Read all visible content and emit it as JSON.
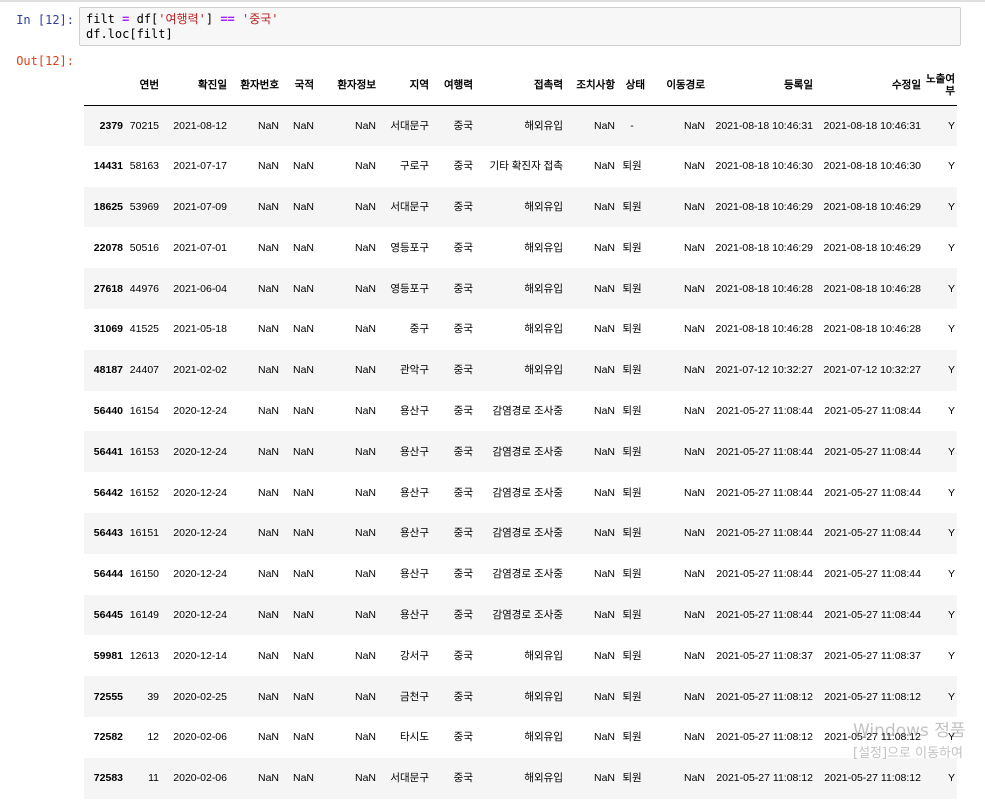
{
  "input_prompt": "In [12]:",
  "output_prompt": "Out[12]:",
  "code": {
    "line1_var": "filt",
    "line1_eq": " = ",
    "line1_df": "df[",
    "line1_key": "'여행력'",
    "line1_close": "] ",
    "line1_op": "==",
    "line1_val": " '중국'",
    "line2": "df.loc[filt]"
  },
  "table": {
    "columns": [
      "",
      "연번",
      "확진일",
      "환자번호",
      "국적",
      "환자정보",
      "지역",
      "여행력",
      "접촉력",
      "조치사항",
      "상태",
      "이동경로",
      "등록일",
      "수정일",
      "노출여부"
    ],
    "rows": [
      {
        "idx": "2379",
        "cells": [
          "70215",
          "2021-08-12",
          "NaN",
          "NaN",
          "NaN",
          "서대문구",
          "중국",
          "해외유입",
          "NaN",
          "-",
          "NaN",
          "2021-08-18 10:46:31",
          "2021-08-18 10:46:31",
          "Y"
        ]
      },
      {
        "idx": "14431",
        "cells": [
          "58163",
          "2021-07-17",
          "NaN",
          "NaN",
          "NaN",
          "구로구",
          "중국",
          "기타 확진자 접촉",
          "NaN",
          "퇴원",
          "NaN",
          "2021-08-18 10:46:30",
          "2021-08-18 10:46:30",
          "Y"
        ]
      },
      {
        "idx": "18625",
        "cells": [
          "53969",
          "2021-07-09",
          "NaN",
          "NaN",
          "NaN",
          "서대문구",
          "중국",
          "해외유입",
          "NaN",
          "퇴원",
          "NaN",
          "2021-08-18 10:46:29",
          "2021-08-18 10:46:29",
          "Y"
        ]
      },
      {
        "idx": "22078",
        "cells": [
          "50516",
          "2021-07-01",
          "NaN",
          "NaN",
          "NaN",
          "영등포구",
          "중국",
          "해외유입",
          "NaN",
          "퇴원",
          "NaN",
          "2021-08-18 10:46:29",
          "2021-08-18 10:46:29",
          "Y"
        ]
      },
      {
        "idx": "27618",
        "cells": [
          "44976",
          "2021-06-04",
          "NaN",
          "NaN",
          "NaN",
          "영등포구",
          "중국",
          "해외유입",
          "NaN",
          "퇴원",
          "NaN",
          "2021-08-18 10:46:28",
          "2021-08-18 10:46:28",
          "Y"
        ]
      },
      {
        "idx": "31069",
        "cells": [
          "41525",
          "2021-05-18",
          "NaN",
          "NaN",
          "NaN",
          "중구",
          "중국",
          "해외유입",
          "NaN",
          "퇴원",
          "NaN",
          "2021-08-18 10:46:28",
          "2021-08-18 10:46:28",
          "Y"
        ]
      },
      {
        "idx": "48187",
        "cells": [
          "24407",
          "2021-02-02",
          "NaN",
          "NaN",
          "NaN",
          "관악구",
          "중국",
          "해외유입",
          "NaN",
          "퇴원",
          "NaN",
          "2021-07-12 10:32:27",
          "2021-07-12 10:32:27",
          "Y"
        ]
      },
      {
        "idx": "56440",
        "cells": [
          "16154",
          "2020-12-24",
          "NaN",
          "NaN",
          "NaN",
          "용산구",
          "중국",
          "감염경로 조사중",
          "NaN",
          "퇴원",
          "NaN",
          "2021-05-27 11:08:44",
          "2021-05-27 11:08:44",
          "Y"
        ]
      },
      {
        "idx": "56441",
        "cells": [
          "16153",
          "2020-12-24",
          "NaN",
          "NaN",
          "NaN",
          "용산구",
          "중국",
          "감염경로 조사중",
          "NaN",
          "퇴원",
          "NaN",
          "2021-05-27 11:08:44",
          "2021-05-27 11:08:44",
          "Y"
        ]
      },
      {
        "idx": "56442",
        "cells": [
          "16152",
          "2020-12-24",
          "NaN",
          "NaN",
          "NaN",
          "용산구",
          "중국",
          "감염경로 조사중",
          "NaN",
          "퇴원",
          "NaN",
          "2021-05-27 11:08:44",
          "2021-05-27 11:08:44",
          "Y"
        ]
      },
      {
        "idx": "56443",
        "cells": [
          "16151",
          "2020-12-24",
          "NaN",
          "NaN",
          "NaN",
          "용산구",
          "중국",
          "감염경로 조사중",
          "NaN",
          "퇴원",
          "NaN",
          "2021-05-27 11:08:44",
          "2021-05-27 11:08:44",
          "Y"
        ]
      },
      {
        "idx": "56444",
        "cells": [
          "16150",
          "2020-12-24",
          "NaN",
          "NaN",
          "NaN",
          "용산구",
          "중국",
          "감염경로 조사중",
          "NaN",
          "퇴원",
          "NaN",
          "2021-05-27 11:08:44",
          "2021-05-27 11:08:44",
          "Y"
        ]
      },
      {
        "idx": "56445",
        "cells": [
          "16149",
          "2020-12-24",
          "NaN",
          "NaN",
          "NaN",
          "용산구",
          "중국",
          "감염경로 조사중",
          "NaN",
          "퇴원",
          "NaN",
          "2021-05-27 11:08:44",
          "2021-05-27 11:08:44",
          "Y"
        ]
      },
      {
        "idx": "59981",
        "cells": [
          "12613",
          "2020-12-14",
          "NaN",
          "NaN",
          "NaN",
          "강서구",
          "중국",
          "해외유입",
          "NaN",
          "퇴원",
          "NaN",
          "2021-05-27 11:08:37",
          "2021-05-27 11:08:37",
          "Y"
        ]
      },
      {
        "idx": "72555",
        "cells": [
          "39",
          "2020-02-25",
          "NaN",
          "NaN",
          "NaN",
          "금천구",
          "중국",
          "해외유입",
          "NaN",
          "퇴원",
          "NaN",
          "2021-05-27 11:08:12",
          "2021-05-27 11:08:12",
          "Y"
        ]
      },
      {
        "idx": "72582",
        "cells": [
          "12",
          "2020-02-06",
          "NaN",
          "NaN",
          "NaN",
          "타시도",
          "중국",
          "해외유입",
          "NaN",
          "퇴원",
          "NaN",
          "2021-05-27 11:08:12",
          "2021-05-27 11:08:12",
          "Y"
        ]
      },
      {
        "idx": "72583",
        "cells": [
          "11",
          "2020-02-06",
          "NaN",
          "NaN",
          "NaN",
          "서대문구",
          "중국",
          "해외유입",
          "NaN",
          "퇴원",
          "NaN",
          "2021-05-27 11:08:12",
          "2021-05-27 11:08:12",
          "Y"
        ]
      }
    ]
  },
  "watermark": {
    "title": "Windows 정품",
    "subtitle": "[설정]으로 이동하여"
  }
}
